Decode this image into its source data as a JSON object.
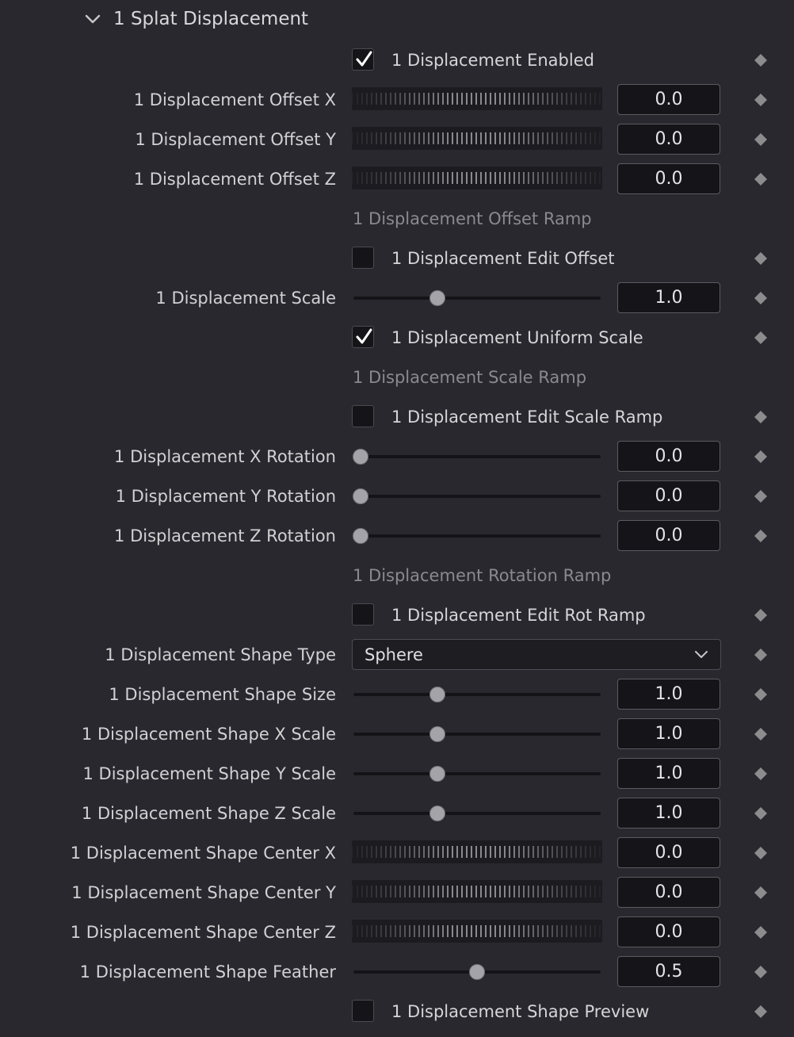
{
  "section": {
    "title": "1 Splat Displacement",
    "expand_icon": "chevron-down-icon"
  },
  "colors": {
    "background": "#28282e",
    "field": "#151519",
    "label": "#d2d2d4",
    "dim_label": "#8a8a8e",
    "keyframe": "#8c8c8e",
    "drag_tick": "#8a8a8e"
  },
  "rows": [
    {
      "type": "checkbox",
      "label": "1 Displacement Enabled",
      "checked": true
    },
    {
      "type": "drag",
      "label": "1 Displacement Offset X",
      "value": "0.0"
    },
    {
      "type": "drag",
      "label": "1 Displacement Offset Y",
      "value": "0.0"
    },
    {
      "type": "drag",
      "label": "1 Displacement Offset Z",
      "value": "0.0"
    },
    {
      "type": "section",
      "label": "1 Displacement Offset Ramp"
    },
    {
      "type": "checkbox",
      "label": "1 Displacement Edit Offset",
      "checked": false
    },
    {
      "type": "slider",
      "label": "1 Displacement Scale",
      "value": "1.0",
      "level": 0.34
    },
    {
      "type": "checkbox",
      "label": "1 Displacement Uniform Scale",
      "checked": true
    },
    {
      "type": "section",
      "label": "1 Displacement Scale Ramp"
    },
    {
      "type": "checkbox",
      "label": "1 Displacement Edit Scale Ramp",
      "checked": false
    },
    {
      "type": "slider",
      "label": "1 Displacement X Rotation",
      "value": "0.0",
      "level": 0.03
    },
    {
      "type": "slider",
      "label": "1 Displacement Y Rotation",
      "value": "0.0",
      "level": 0.03
    },
    {
      "type": "slider",
      "label": "1 Displacement Z Rotation",
      "value": "0.0",
      "level": 0.03
    },
    {
      "type": "section",
      "label": "1 Displacement Rotation Ramp"
    },
    {
      "type": "checkbox",
      "label": "1 Displacement Edit Rot Ramp",
      "checked": false
    },
    {
      "type": "select",
      "label": "1 Displacement Shape Type",
      "value": "Sphere"
    },
    {
      "type": "slider",
      "label": "1 Displacement Shape Size",
      "value": "1.0",
      "level": 0.34
    },
    {
      "type": "slider",
      "label": "1 Displacement Shape X Scale",
      "value": "1.0",
      "level": 0.34
    },
    {
      "type": "slider",
      "label": "1 Displacement Shape Y Scale",
      "value": "1.0",
      "level": 0.34
    },
    {
      "type": "slider",
      "label": "1 Displacement Shape Z Scale",
      "value": "1.0",
      "level": 0.34
    },
    {
      "type": "drag",
      "label": "1 Displacement Shape Center X",
      "value": "0.0"
    },
    {
      "type": "drag",
      "label": "1 Displacement Shape Center Y",
      "value": "0.0"
    },
    {
      "type": "drag",
      "label": "1 Displacement Shape Center Z",
      "value": "0.0"
    },
    {
      "type": "slider",
      "label": "1 Displacement Shape Feather",
      "value": "0.5",
      "level": 0.5
    },
    {
      "type": "checkbox",
      "label": "1 Displacement Shape Preview",
      "checked": false
    }
  ]
}
